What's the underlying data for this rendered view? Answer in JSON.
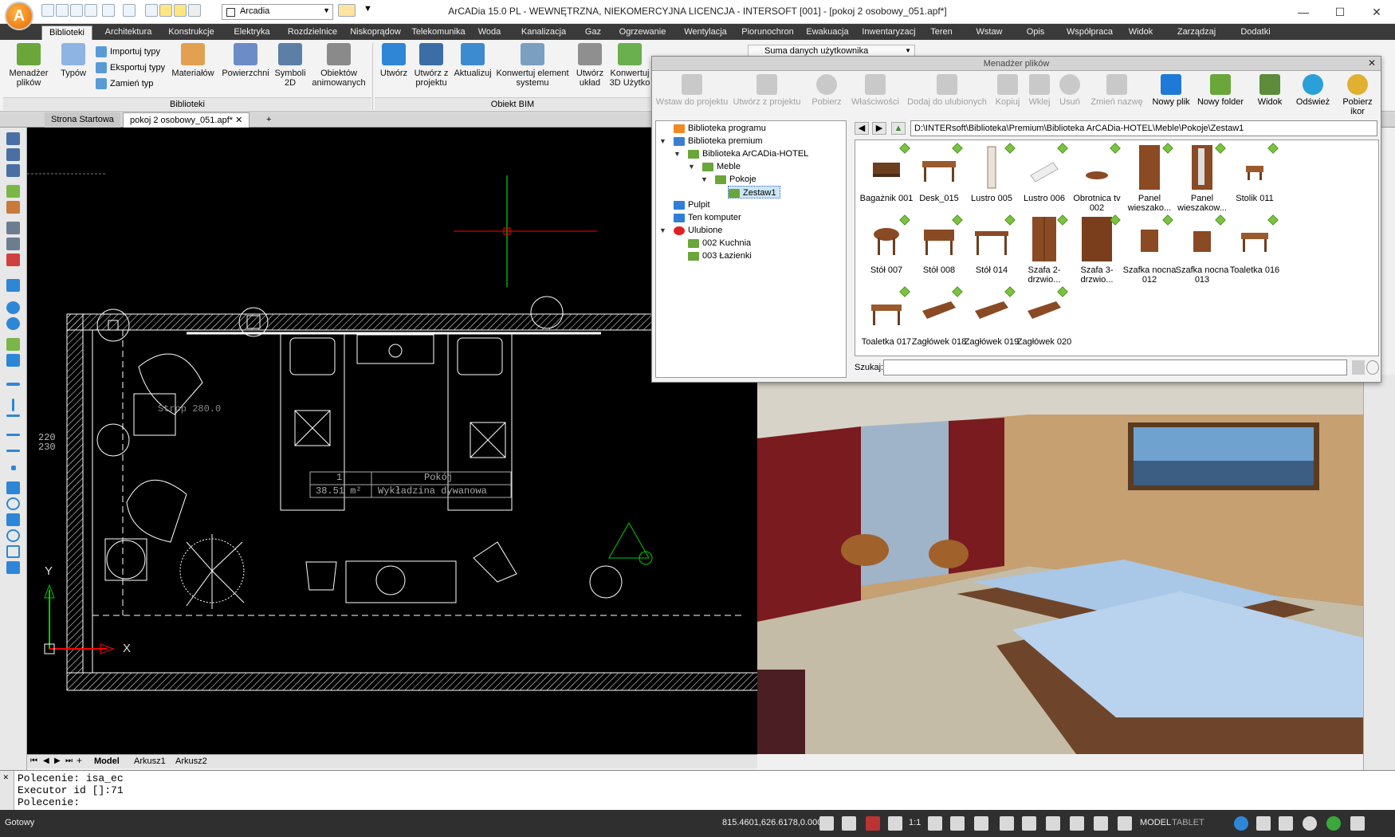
{
  "window": {
    "title": "ArCADia 15.0 PL - WEWNĘTRZNA, NIEKOMERCYJNA LICENCJA - INTERSOFT [001] - [pokoj 2 osobowy_051.apf*]",
    "layer_name": "Arcadia"
  },
  "ribbon_tabs": [
    "Biblioteki",
    "Architektura",
    "Konstrukcje",
    "Elektryka",
    "Rozdzielnice",
    "Niskoprądow",
    "Telekomunika",
    "Woda",
    "Kanalizacja",
    "Gaz",
    "Ogrzewanie",
    "Wentylacja",
    "Piorunochron",
    "Ewakuacja",
    "Inwentaryzacj",
    "Teren",
    "Wstaw",
    "Opis",
    "Współpraca",
    "Widok",
    "Zarządzaj",
    "Dodatki"
  ],
  "ribbon": {
    "biblioteki": {
      "menadzer": "Menadżer plików",
      "typow": "Typów",
      "importuj": "Importuj typy",
      "eksportuj": "Eksportuj typy",
      "zamien": "Zamień typ",
      "materialow": "Materiałów",
      "powierzchni": "Powierzchni",
      "symboli": "Symboli 2D",
      "obiektow": "Obiektów animowanych",
      "group_label": "Biblioteki"
    },
    "bim": {
      "utworz": "Utwórz",
      "utworz_z": "Utwórz z projektu",
      "aktualizuj": "Aktualizuj",
      "konwertuj": "Konwertuj element systemu",
      "utworz_uklad": "Utwórz układ",
      "konwertuj3d": "Konwertuj 3D Użytko",
      "group_label": "Obiekt BIM"
    },
    "user_data": "Suma danych użytkownika"
  },
  "doc_tabs": [
    "Strona Startowa",
    "pokoj 2 osobowy_051.apf*"
  ],
  "drawing": {
    "ceiling_label": "Strop 280.0",
    "room_number": "1",
    "room_name": "Pokój",
    "room_area": "38.51 m²",
    "room_floor": "Wykładzina dywanowa",
    "dim1": "220",
    "dim2": "230",
    "axis_x": "X",
    "axis_y": "Y"
  },
  "sheet_tabs": [
    "Model",
    "Arkusz1",
    "Arkusz2"
  ],
  "command": {
    "line1": "Polecenie: isa_ec",
    "line2": "Executor id []:71",
    "line3": "Polecenie:"
  },
  "status": {
    "ready": "Gotowy",
    "coords": "815.4601,626.6178,0.0000",
    "scale": "1:1",
    "model": "MODEL",
    "tablet": "TABLET"
  },
  "file_manager": {
    "title": "Menadżer plików",
    "toolbar": [
      {
        "label": "Wstaw do projektu",
        "enabled": false
      },
      {
        "label": "Utwórz z projektu",
        "enabled": false
      },
      {
        "label": "Pobierz",
        "enabled": false
      },
      {
        "label": "Właściwości",
        "enabled": false
      },
      {
        "label": "Dodaj do ulubionych",
        "enabled": false
      },
      {
        "label": "Kopiuj",
        "enabled": false
      },
      {
        "label": "Wklej",
        "enabled": false
      },
      {
        "label": "Usuń",
        "enabled": false
      },
      {
        "label": "Zmień nazwę",
        "enabled": false
      },
      {
        "label": "Nowy plik",
        "enabled": true
      },
      {
        "label": "Nowy folder",
        "enabled": true
      },
      {
        "label": "Widok",
        "enabled": true
      },
      {
        "label": "Odśwież",
        "enabled": true
      },
      {
        "label": "Pobierz ikor",
        "enabled": true
      }
    ],
    "tree": [
      {
        "label": "Biblioteka programu",
        "level": 0,
        "icon": "arcadia"
      },
      {
        "label": "Biblioteka premium",
        "level": 0,
        "icon": "crown",
        "expanded": true
      },
      {
        "label": "Biblioteka ArCADia-HOTEL",
        "level": 1,
        "icon": "folder",
        "expanded": true
      },
      {
        "label": "Meble",
        "level": 2,
        "icon": "folder",
        "expanded": true
      },
      {
        "label": "Pokoje",
        "level": 3,
        "icon": "folder",
        "expanded": true
      },
      {
        "label": "Zestaw1",
        "level": 4,
        "icon": "folder",
        "selected": true
      },
      {
        "label": "Pulpit",
        "level": 0,
        "icon": "desktop"
      },
      {
        "label": "Ten komputer",
        "level": 0,
        "icon": "computer"
      },
      {
        "label": "Ulubione",
        "level": 0,
        "icon": "heart",
        "expanded": true
      },
      {
        "label": "002 Kuchnia",
        "level": 1,
        "icon": "fav-folder"
      },
      {
        "label": "003 Łazienki",
        "level": 1,
        "icon": "fav-folder"
      }
    ],
    "path": "D:\\INTERsoft\\Biblioteka\\Premium\\Biblioteka ArCADia-HOTEL\\Meble\\Pokoje\\Zestaw1",
    "items": [
      "Bagażnik 001",
      "Desk_015",
      "Lustro 005",
      "Lustro 006",
      "Obrotnica tv 002",
      "Panel wieszako...",
      "Panel wieszakow...",
      "Stolik 011",
      "Stół 007",
      "Stół 008",
      "Stół 014",
      "Szafa 2-drzwio...",
      "Szafa 3-drzwio...",
      "Szafka nocna 012",
      "Szafka nocna 013",
      "Toaletka 016",
      "Toaletka 017",
      "Zagłówek 018",
      "Zagłówek 019",
      "Zagłówek 020"
    ],
    "search_label": "Szukaj:"
  }
}
